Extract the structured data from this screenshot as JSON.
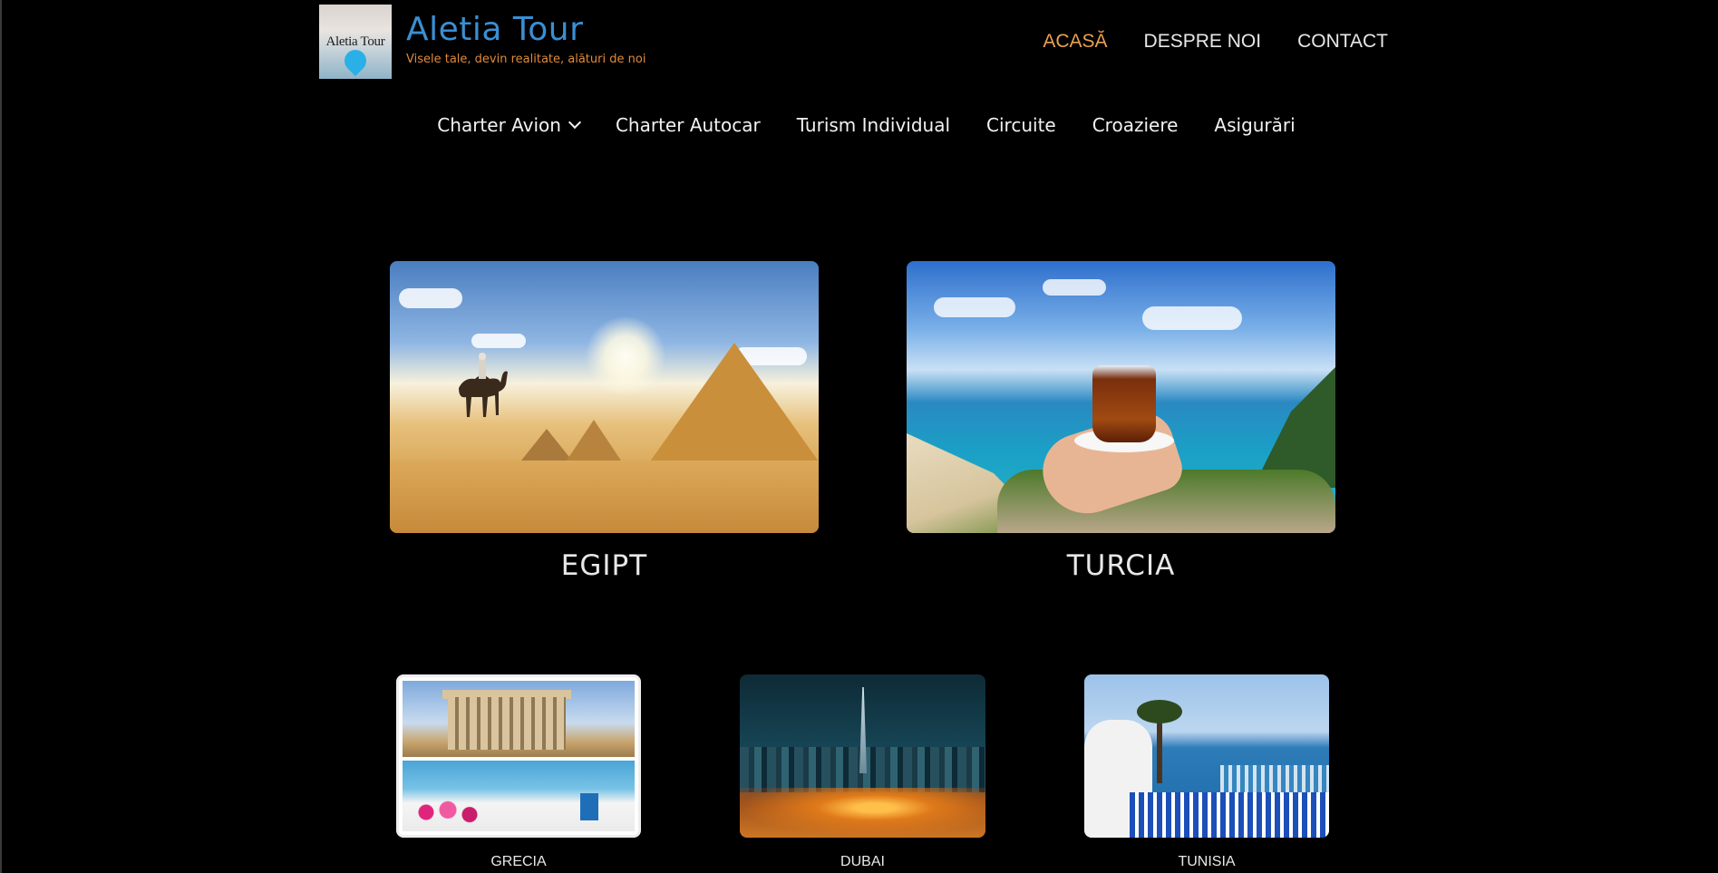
{
  "brand": {
    "logo_text": "Aletia Tour",
    "title": "Aletia Tour",
    "tagline": "Visele tale, devin realitate, alături de noi"
  },
  "top_nav": {
    "items": [
      {
        "label": "ACASĂ",
        "active": true
      },
      {
        "label": "DESPRE NOI",
        "active": false
      },
      {
        "label": "CONTACT",
        "active": false
      }
    ]
  },
  "sub_nav": {
    "items": [
      {
        "label": "Charter Avion",
        "has_dropdown": true,
        "dropdown_icon": "chevron-down-icon"
      },
      {
        "label": "Charter Autocar"
      },
      {
        "label": "Turism Individual"
      },
      {
        "label": "Circuite"
      },
      {
        "label": "Croaziere"
      },
      {
        "label": "Asigurări"
      }
    ]
  },
  "featured_destinations": [
    {
      "title": "EGIPT",
      "image": "pyramids-camel-desert"
    },
    {
      "title": "TURCIA",
      "image": "turkish-tea-sea-view"
    }
  ],
  "destinations": [
    {
      "title": "GRECIA",
      "image": "parthenon-santorini"
    },
    {
      "title": "DUBAI",
      "image": "dubai-skyline-night"
    },
    {
      "title": "TUNISIA",
      "image": "tunisia-sidi-bou-said"
    }
  ],
  "colors": {
    "background": "#000000",
    "title_blue": "#3a8fd3",
    "tagline_orange": "#e08a3a",
    "active_nav": "#e8a152",
    "nav_text": "#e8e8e8"
  }
}
